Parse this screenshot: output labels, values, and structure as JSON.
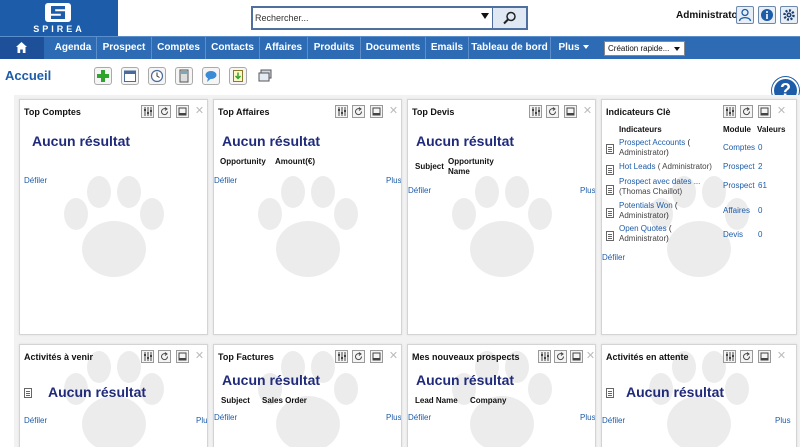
{
  "header": {
    "logo_text": "SPIREA",
    "search_placeholder": "Rechercher...",
    "user_name": "Administrator",
    "icons": [
      "user-icon",
      "info-icon",
      "settings-icon"
    ]
  },
  "nav": {
    "items": [
      "Agenda",
      "Prospect",
      "Comptes",
      "Contacts",
      "Affaires",
      "Produits",
      "Documents",
      "Emails",
      "Tableau de bord",
      "Plus"
    ],
    "quick_create": "Création rapide..."
  },
  "page": {
    "title": "Accueil",
    "help": "?"
  },
  "common": {
    "empty": "Aucun résultat",
    "scroll": "Défiler",
    "more": "Plus"
  },
  "widgets": [
    {
      "title": "Top Comptes"
    },
    {
      "title": "Top Affaires",
      "columns": [
        "Opportunity",
        "Amount(€)"
      ]
    },
    {
      "title": "Top Devis",
      "columns": [
        "Subject",
        "Opportunity Name"
      ]
    },
    {
      "title": "Indicateurs Clè",
      "headers": [
        "Indicateurs",
        "Module",
        "Valeurs"
      ],
      "rows": [
        {
          "name": "Prospect Accounts",
          "owner": "Administrator",
          "module": "Comptes",
          "value": "0"
        },
        {
          "name": "Hot Leads",
          "owner": "Administrator",
          "module": "Prospect",
          "value": "2"
        },
        {
          "name": "Prospect avec dates ...",
          "owner": "Thomas Chaillot",
          "module": "Prospect",
          "value": "61"
        },
        {
          "name": "Potentials Won",
          "owner": "Administrator",
          "module": "Affaires",
          "value": "0"
        },
        {
          "name": "Open Quotes",
          "owner": "Administrator",
          "module": "Devis",
          "value": "0"
        }
      ]
    },
    {
      "title": "Activités à venir"
    },
    {
      "title": "Top Factures",
      "columns": [
        "Subject",
        "Sales Order"
      ]
    },
    {
      "title": "Mes nouveaux prospects",
      "columns": [
        "Lead Name",
        "Company"
      ]
    },
    {
      "title": "Activités en attente"
    }
  ]
}
